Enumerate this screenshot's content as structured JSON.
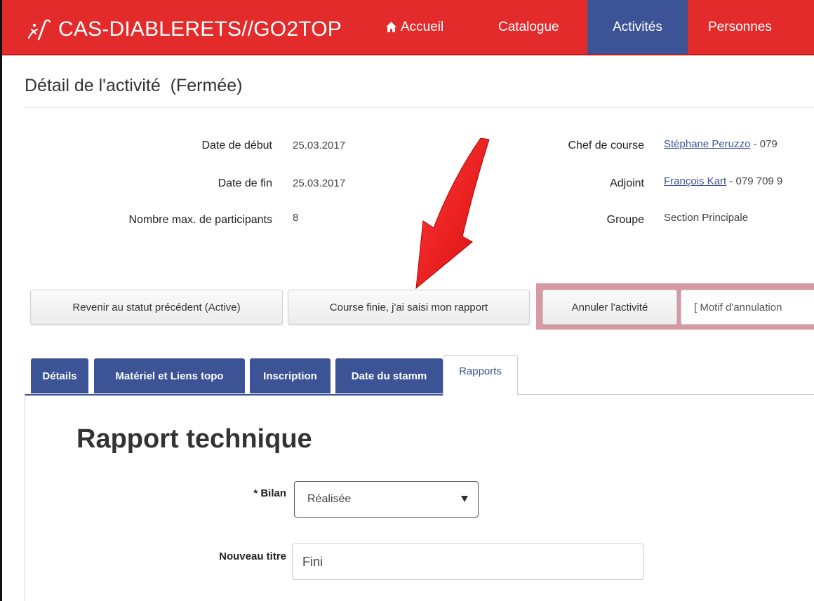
{
  "navbar": {
    "brand": "CAS-DIABLERETS//GO2TOP",
    "brand_icon": "climber-icon",
    "color": "#e32b2b",
    "active_color": "#3c5396",
    "items": [
      {
        "label": "Accueil",
        "icon": "home-icon"
      },
      {
        "label": "Catalogue"
      },
      {
        "label": "Activités",
        "active": true
      },
      {
        "label": "Personnes"
      }
    ]
  },
  "page": {
    "title": "Détail de l'activité  (Fermée)"
  },
  "details": {
    "start_date_label": "Date de début",
    "start_date": "25.03.2017",
    "end_date_label": "Date de fin",
    "end_date": "25.03.2017",
    "max_participants_label": "Nombre max. de participants",
    "max_participants": "8",
    "leader_label": "Chef de course",
    "leader_name": "Stéphane Peruzzo",
    "leader_phone": " - 079",
    "assistant_label": "Adjoint",
    "assistant_name": "François Kart",
    "assistant_phone": " - 079 709 9",
    "group_label": "Groupe",
    "group": "Section Principale"
  },
  "actions": {
    "previous_status": "Revenir au statut précédent (Active)",
    "course_done": "Course finie, j'ai saisi mon rapport",
    "cancel": "Annuler l'activité",
    "cancel_reason_placeholder": "[ Motif d'annulation"
  },
  "tabs": [
    {
      "label": "Détails"
    },
    {
      "label": "Matériel et Liens topo"
    },
    {
      "label": "Inscription"
    },
    {
      "label": "Date du stamm"
    },
    {
      "label": "Rapports",
      "active": true
    }
  ],
  "report": {
    "title": "Rapport technique",
    "bilan_label": "* Bilan",
    "bilan_value": "Réalisée",
    "new_title_label": "Nouveau titre",
    "new_title_value": "Fini"
  },
  "annotation": {
    "arrow_color": "#f01818"
  }
}
